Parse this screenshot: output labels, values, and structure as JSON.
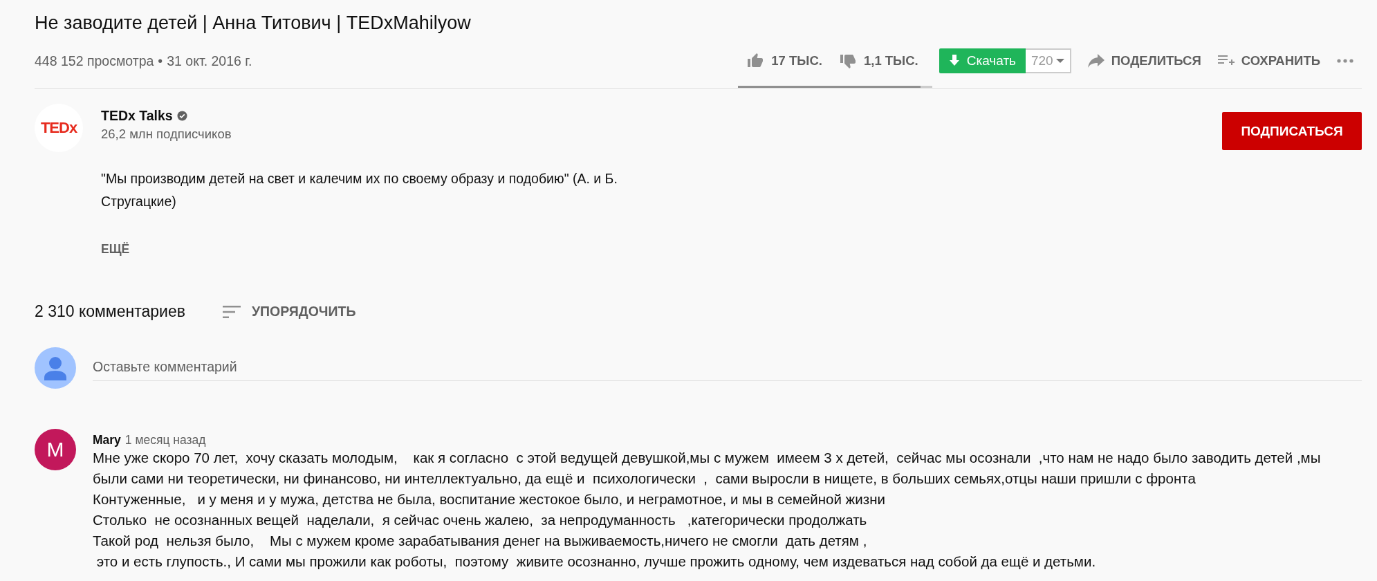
{
  "video": {
    "title": "Не заводите детей | Анна Титович | TEDxMahilyow",
    "views": "448 152 просмотра",
    "separator": "•",
    "date": "31 окт. 2016 г."
  },
  "actions": {
    "likes": "17 ТЫС.",
    "dislikes": "1,1 ТЫС.",
    "sentiment": {
      "level": 0.94
    },
    "download": {
      "label": "Скачать",
      "quality": "720"
    },
    "share": "ПОДЕЛИТЬСЯ",
    "save": "СОХРАНИТЬ"
  },
  "channel": {
    "name": "TEDx Talks",
    "logo": "TEDx",
    "verified": true,
    "subscribers": "26,2 млн подписчиков",
    "subscribe": "ПОДПИСАТЬСЯ"
  },
  "description": {
    "lines": [
      "\"Мы производим детей на свет и калечим их по своему образу и подобию\" (А. и Б.",
      "Стругацкие)"
    ],
    "more": "ЕЩЁ"
  },
  "comments_header": {
    "count": "2 310 комментариев",
    "sort": "УПОРЯДОЧИТЬ"
  },
  "comment_input": {
    "placeholder": "Оставьте комментарий"
  },
  "comments": [
    {
      "author": "Mary",
      "initial": "M",
      "color": "#c2185b",
      "time": "1 месяц назад",
      "lines": [
        "Мне уже скоро 70 лет,  хочу сказать молодым,    как я согласно  с этой ведущей девушкой,мы с мужем  имеем 3 х детей,  сейчас мы осознали  ,что нам не надо было заводить детей ,мы",
        "были сами ни теоретически, ни финансово, ни интеллектуально, да ещё и  психологически  ,  сами выросли в нищете, в больших семьях,отцы наши пришли с фронта",
        "Контуженные,   и у меня и у мужа, детства не была, воспитание жестокое было, и неграмотное, и мы в семейной жизни",
        "Столько  не осознанных вещей  наделали,  я сейчас очень жалею,  за непродуманность   ,категорически продолжать",
        "Такой род  нельзя было,    Мы с мужем кроме зарабатывания денег на выживаемость,ничего не смогли  дать детям ,",
        " это и есть глупость., И сами мы прожили как роботы,  поэтому  живите осознанно, лучше прожить одному, чем издеваться над собой да ещё и детьми."
      ]
    }
  ]
}
